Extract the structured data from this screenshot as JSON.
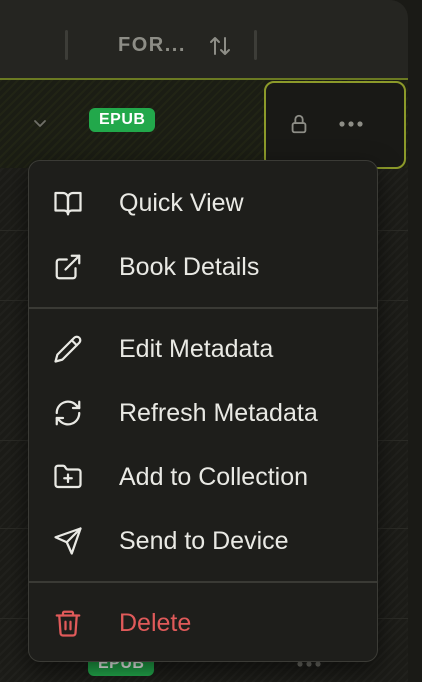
{
  "header": {
    "format_column_label": "FOR...",
    "sort_icon": "sort-arrows-icon"
  },
  "rows": [
    {
      "format_badge": "EPUB",
      "expand_icon": "chevron-down-icon",
      "lock_icon": "lock-icon",
      "more_icon": "more-horizontal-icon"
    },
    {
      "format_badge": "EPUB"
    }
  ],
  "context_menu": {
    "items": [
      {
        "label": "Quick View",
        "icon": "book-open-icon"
      },
      {
        "label": "Book Details",
        "icon": "external-link-icon"
      },
      {
        "label": "Edit Metadata",
        "icon": "pencil-icon"
      },
      {
        "label": "Refresh Metadata",
        "icon": "refresh-icon"
      },
      {
        "label": "Add to Collection",
        "icon": "folder-plus-icon"
      },
      {
        "label": "Send to Device",
        "icon": "send-icon"
      },
      {
        "label": "Delete",
        "icon": "trash-icon"
      }
    ]
  },
  "colors": {
    "accent_border": "#8c9a2a",
    "badge_green": "#22a84b",
    "danger": "#e05a5a",
    "menu_bg": "#1e1e1b"
  }
}
